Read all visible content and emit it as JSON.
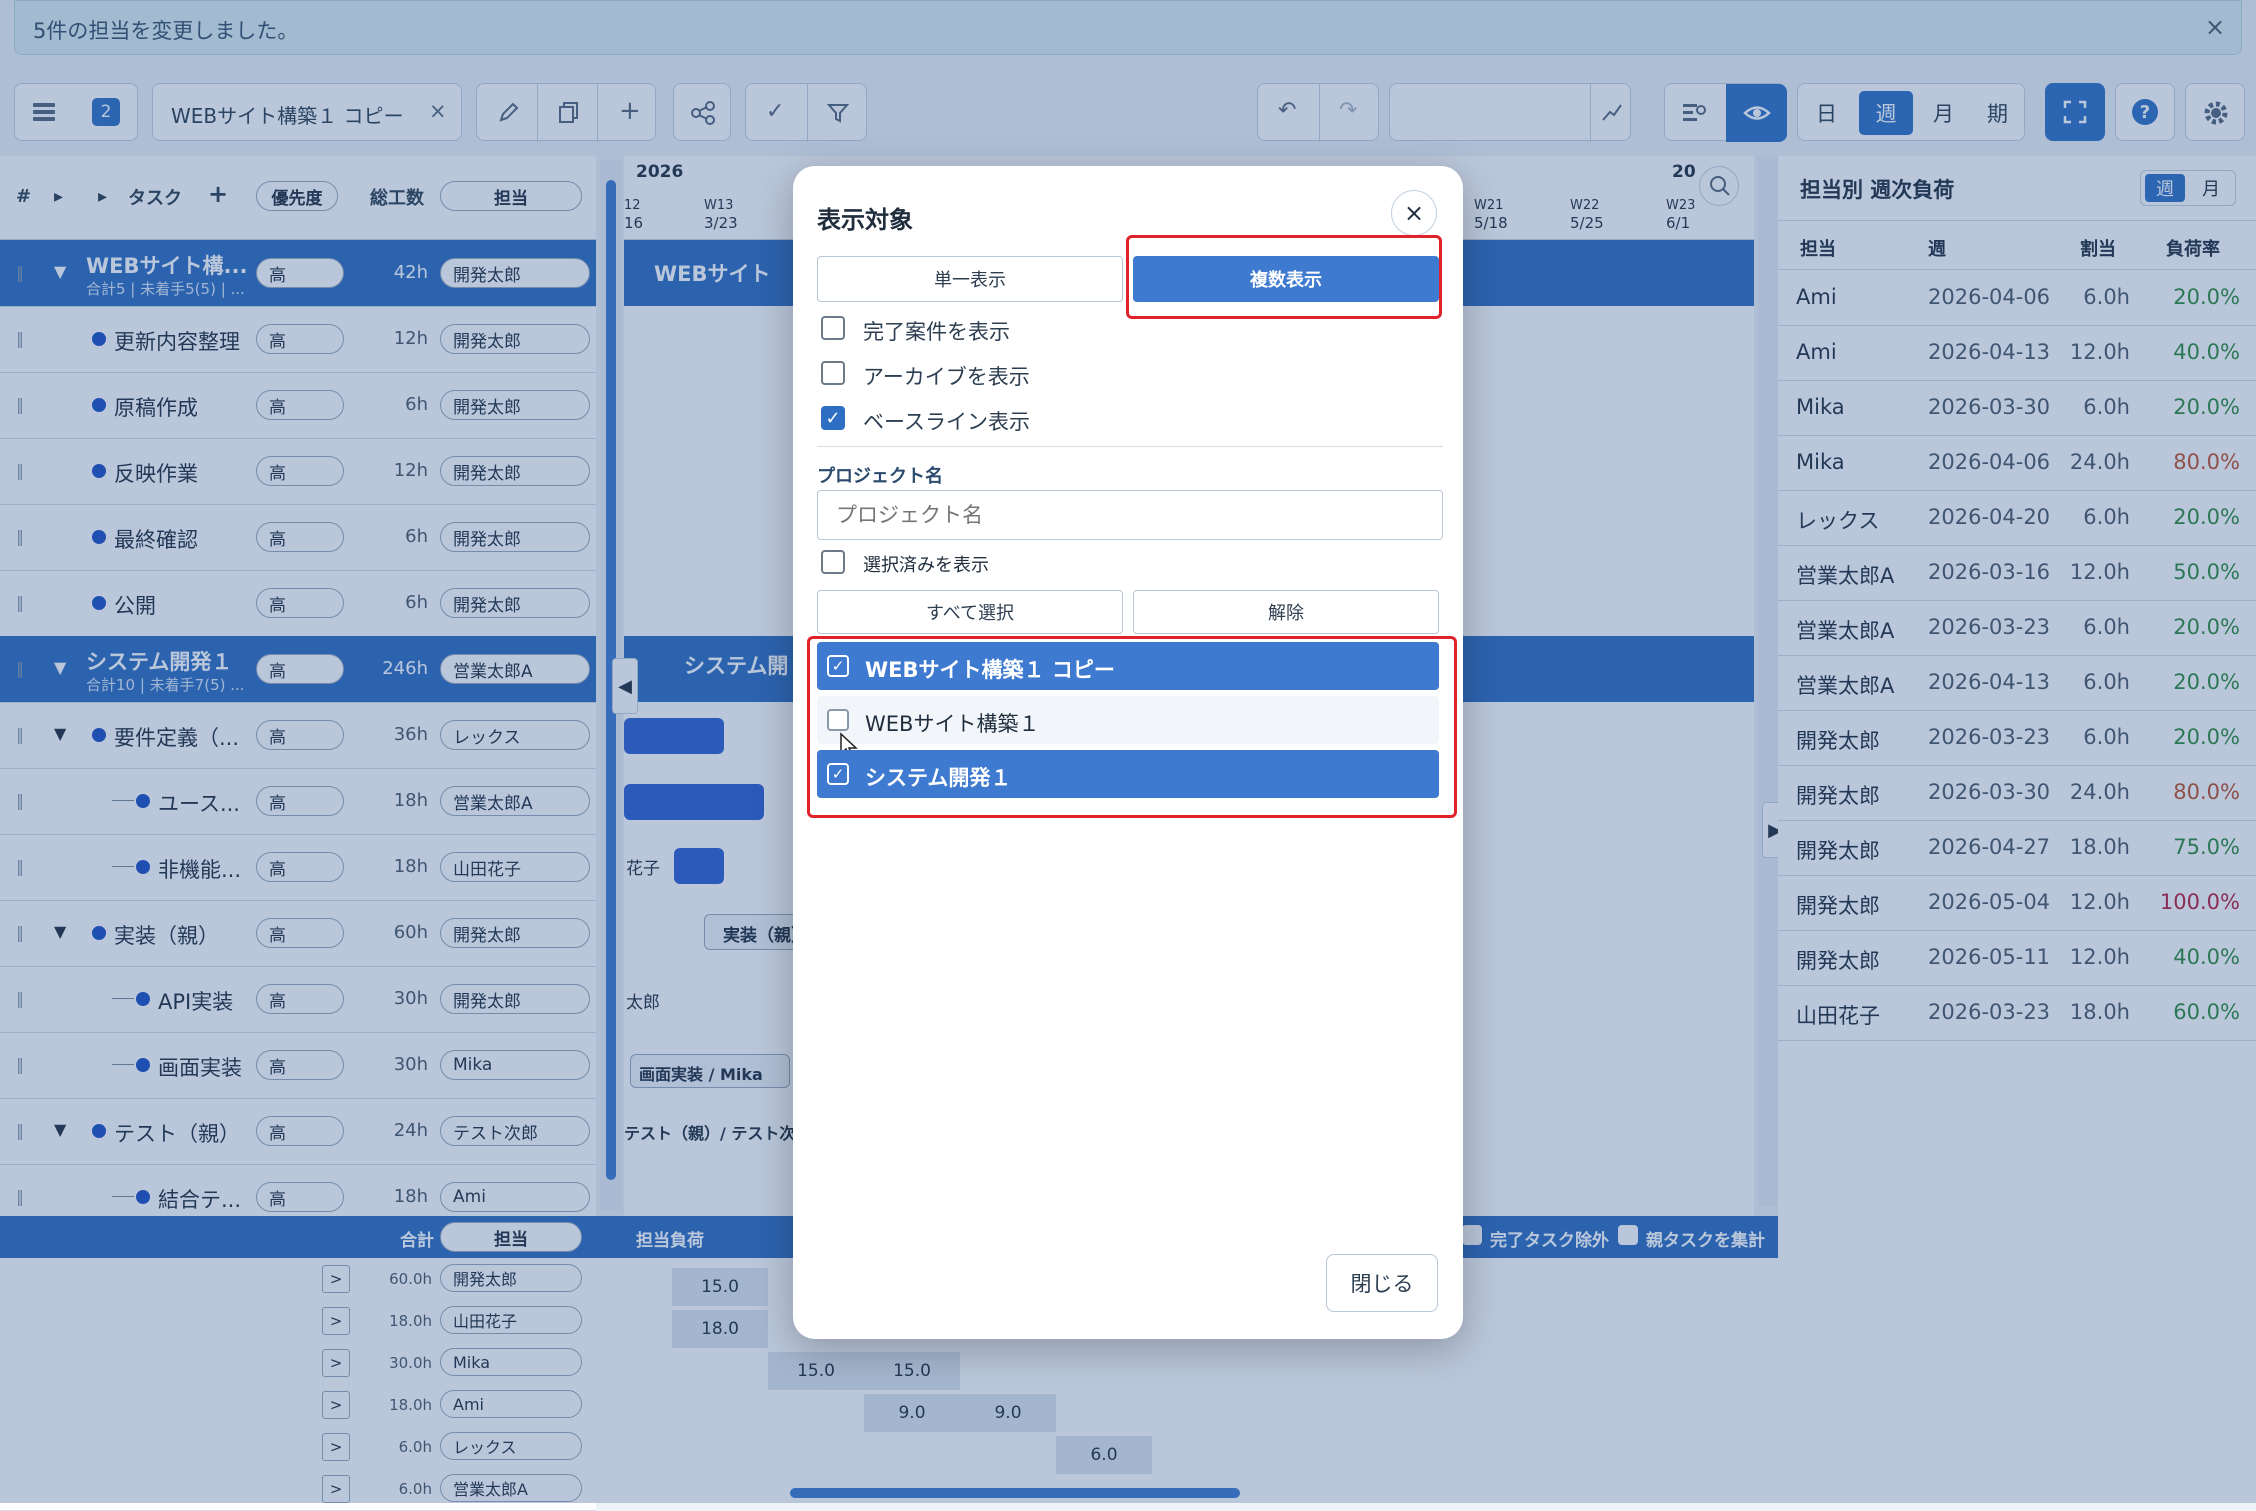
{
  "notification": {
    "text": "5件の担当を変更しました。",
    "close": "×"
  },
  "toolbar": {
    "badge": "2",
    "project_tab": "WEBサイト構築１ コピー",
    "tab_close": "×",
    "view_day": "日",
    "view_week": "週",
    "view_month": "月",
    "view_period": "期"
  },
  "grid_header": {
    "num": "#",
    "task": "タスク",
    "add": "+",
    "priority": "優先度",
    "total_hours": "総工数",
    "assignee": "担当"
  },
  "timeline_header": {
    "year": "2026",
    "col1": "12",
    "col1b": "16",
    "w13": "W13",
    "d13": "3/23",
    "w21": "W21",
    "d21": "5/18",
    "w22": "W22",
    "d22": "5/25",
    "w23": "W23",
    "d23": "6/1",
    "year2": "20"
  },
  "rows": [
    {
      "name": "WEBサイト構...",
      "sub": "合計5 | 未着手5(5) | ...",
      "priority": "高",
      "hours": "42h",
      "assignee": "開発太郎",
      "kind": "project"
    },
    {
      "name": "更新内容整理",
      "priority": "高",
      "hours": "12h",
      "assignee": "開発太郎",
      "kind": "task"
    },
    {
      "name": "原稿作成",
      "priority": "高",
      "hours": "6h",
      "assignee": "開発太郎",
      "kind": "task"
    },
    {
      "name": "反映作業",
      "priority": "高",
      "hours": "12h",
      "assignee": "開発太郎",
      "kind": "task"
    },
    {
      "name": "最終確認",
      "priority": "高",
      "hours": "6h",
      "assignee": "開発太郎",
      "kind": "task"
    },
    {
      "name": "公開",
      "priority": "高",
      "hours": "6h",
      "assignee": "開発太郎",
      "kind": "task"
    },
    {
      "name": "システム開発１",
      "sub": "合計10 | 未着手7(5) ...",
      "priority": "高",
      "hours": "246h",
      "assignee": "営業太郎A",
      "kind": "project"
    },
    {
      "name": "要件定義（...",
      "priority": "高",
      "hours": "36h",
      "assignee": "レックス",
      "kind": "parent"
    },
    {
      "name": "ユース...",
      "priority": "高",
      "hours": "18h",
      "assignee": "営業太郎A",
      "kind": "child"
    },
    {
      "name": "非機能...",
      "priority": "高",
      "hours": "18h",
      "assignee": "山田花子",
      "kind": "child"
    },
    {
      "name": "実装（親）",
      "priority": "高",
      "hours": "60h",
      "assignee": "開発太郎",
      "kind": "parent"
    },
    {
      "name": "API実装",
      "priority": "高",
      "hours": "30h",
      "assignee": "開発太郎",
      "kind": "child"
    },
    {
      "name": "画面実装",
      "priority": "高",
      "hours": "30h",
      "assignee": "Mika",
      "kind": "child"
    },
    {
      "name": "テスト（親）",
      "priority": "高",
      "hours": "24h",
      "assignee": "テスト次郎",
      "kind": "parent"
    },
    {
      "name": "結合テ...",
      "priority": "高",
      "hours": "18h",
      "assignee": "Ami",
      "kind": "child"
    }
  ],
  "gantt_labels": {
    "web": "WEBサイト",
    "sys": "システム開",
    "hanako": "花子",
    "impl": "実装（親）/",
    "taro": "太郎",
    "screen": "画面実装 / Mika",
    "test": "テスト（親）/ テスト次"
  },
  "bottom": {
    "total": "合計",
    "assignee": "担当",
    "load": "担当負荷",
    "exclude_done": "完了タスク除外",
    "aggregate_parent": "親タスクを集計",
    "rows": [
      {
        "expand": ">",
        "hours": "60.0h",
        "name": "開発太郎"
      },
      {
        "expand": ">",
        "hours": "18.0h",
        "name": "山田花子"
      },
      {
        "expand": ">",
        "hours": "30.0h",
        "name": "Mika"
      },
      {
        "expand": ">",
        "hours": "18.0h",
        "name": "Ami"
      },
      {
        "expand": ">",
        "hours": "6.0h",
        "name": "レックス"
      },
      {
        "expand": ">",
        "hours": "6.0h",
        "name": "営業太郎A"
      }
    ],
    "cells": {
      "r1a": "15.0",
      "r2a": "18.0",
      "r3a": "15.0",
      "r3b": "15.0",
      "r4a": "9.0",
      "r4b": "9.0",
      "r5a": "6.0"
    }
  },
  "modal": {
    "title": "表示対象",
    "close": "×",
    "single": "単一表示",
    "multi": "複数表示",
    "opt_done": "完了案件を表示",
    "opt_archive": "アーカイブを表示",
    "opt_baseline": "ベースライン表示",
    "project_label": "プロジェクト名",
    "project_placeholder": "プロジェクト名",
    "show_selected": "選択済みを表示",
    "select_all": "すべて選択",
    "deselect": "解除",
    "projects": [
      {
        "name": "WEBサイト構築１ コピー",
        "checked": true
      },
      {
        "name": "WEBサイト構築１",
        "checked": false
      },
      {
        "name": "システム開発１",
        "checked": true
      }
    ],
    "close_button": "閉じる"
  },
  "right_panel": {
    "title": "担当別 週次負荷",
    "toggle_week": "週",
    "toggle_month": "月",
    "headers": {
      "assignee": "担当",
      "week": "週",
      "alloc": "割当",
      "rate": "負荷率"
    },
    "rows": [
      {
        "name": "Ami",
        "week": "2026-04-06",
        "alloc": "6.0h",
        "rate": "20.0%",
        "color": "#2e8b3d"
      },
      {
        "name": "Ami",
        "week": "2026-04-13",
        "alloc": "12.0h",
        "rate": "40.0%",
        "color": "#2e8b3d"
      },
      {
        "name": "Mika",
        "week": "2026-03-30",
        "alloc": "6.0h",
        "rate": "20.0%",
        "color": "#2e8b3d"
      },
      {
        "name": "Mika",
        "week": "2026-04-06",
        "alloc": "24.0h",
        "rate": "80.0%",
        "color": "#c0502a"
      },
      {
        "name": "レックス",
        "week": "2026-04-20",
        "alloc": "6.0h",
        "rate": "20.0%",
        "color": "#2e8b3d"
      },
      {
        "name": "営業太郎A",
        "week": "2026-03-16",
        "alloc": "12.0h",
        "rate": "50.0%",
        "color": "#2e8b3d"
      },
      {
        "name": "営業太郎A",
        "week": "2026-03-23",
        "alloc": "6.0h",
        "rate": "20.0%",
        "color": "#2e8b3d"
      },
      {
        "name": "営業太郎A",
        "week": "2026-04-13",
        "alloc": "6.0h",
        "rate": "20.0%",
        "color": "#2e8b3d"
      },
      {
        "name": "開発太郎",
        "week": "2026-03-23",
        "alloc": "6.0h",
        "rate": "20.0%",
        "color": "#2e8b3d"
      },
      {
        "name": "開発太郎",
        "week": "2026-03-30",
        "alloc": "24.0h",
        "rate": "80.0%",
        "color": "#c0502a"
      },
      {
        "name": "開発太郎",
        "week": "2026-04-27",
        "alloc": "18.0h",
        "rate": "75.0%",
        "color": "#2e8b3d"
      },
      {
        "name": "開発太郎",
        "week": "2026-05-04",
        "alloc": "12.0h",
        "rate": "100.0%",
        "color": "#b81d3a"
      },
      {
        "name": "開発太郎",
        "week": "2026-05-11",
        "alloc": "12.0h",
        "rate": "40.0%",
        "color": "#2e8b3d"
      },
      {
        "name": "山田花子",
        "week": "2026-03-23",
        "alloc": "18.0h",
        "rate": "60.0%",
        "color": "#2e8b3d"
      }
    ]
  }
}
